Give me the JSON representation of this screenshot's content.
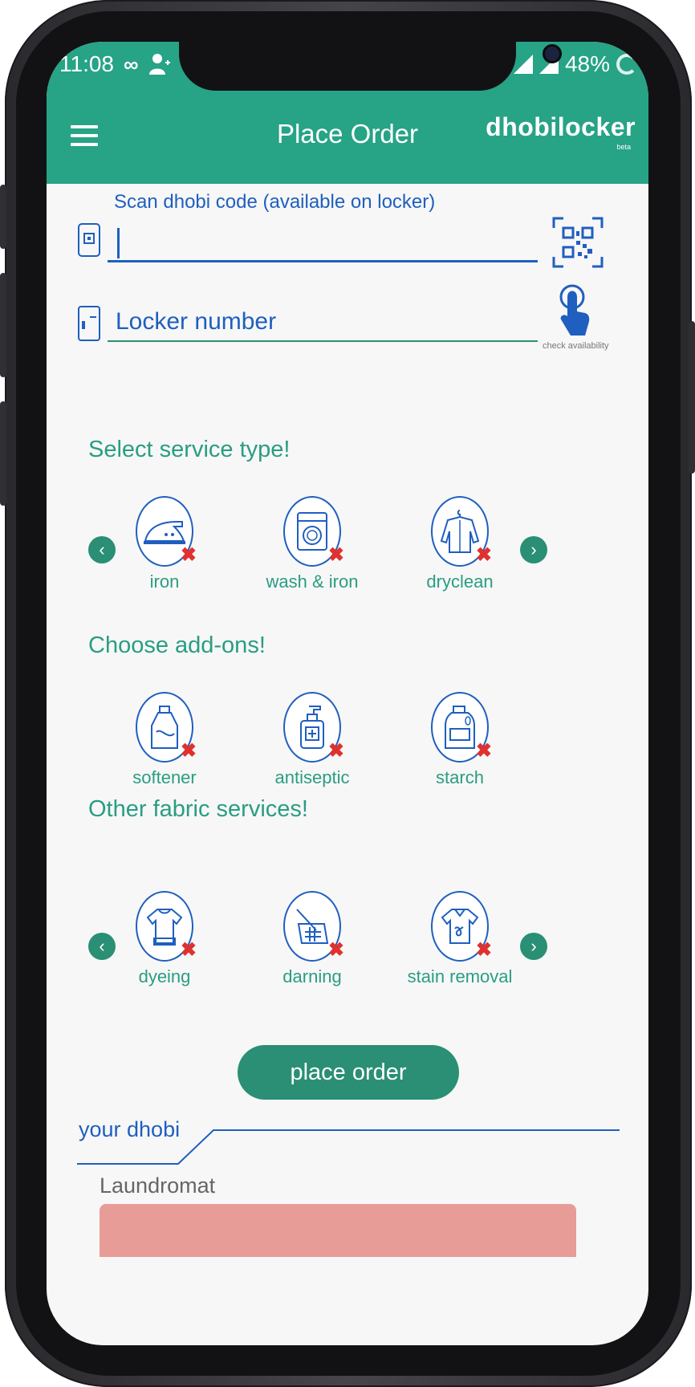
{
  "status_bar": {
    "time": "11:08",
    "battery": "48%"
  },
  "header": {
    "title": "Place Order",
    "brand": "dhobilocker",
    "brand_badge": "beta"
  },
  "form": {
    "scan_label": "Scan dhobi code (available on locker)",
    "scan_value": "",
    "locker_placeholder": "Locker number",
    "check_availability": "check availability"
  },
  "service_type": {
    "title": "Select service type!",
    "items": [
      {
        "label": "iron",
        "icon": "iron-icon"
      },
      {
        "label": "wash & iron",
        "icon": "washing-machine-icon"
      },
      {
        "label": "dryclean",
        "icon": "shirt-hanger-icon"
      }
    ]
  },
  "addons": {
    "title": "Choose add-ons!",
    "items": [
      {
        "label": "softener",
        "icon": "softener-bottle-icon"
      },
      {
        "label": "antiseptic",
        "icon": "antiseptic-bottle-icon"
      },
      {
        "label": "starch",
        "icon": "starch-bottle-icon"
      }
    ]
  },
  "fabric": {
    "title": "Other fabric services!",
    "items": [
      {
        "label": "dyeing",
        "icon": "tshirt-dye-icon"
      },
      {
        "label": "darning",
        "icon": "needle-fabric-icon"
      },
      {
        "label": "stain removal",
        "icon": "stained-shirt-icon"
      }
    ]
  },
  "place_order_label": "place order",
  "your_dhobi": {
    "title": "your dhobi",
    "shop_name": "Laundromat"
  },
  "colors": {
    "primary": "#27a386",
    "accent_blue": "#1f5fbf",
    "button": "#2a8f74",
    "remove": "#e0312f",
    "shop_card": "#e89c98"
  }
}
